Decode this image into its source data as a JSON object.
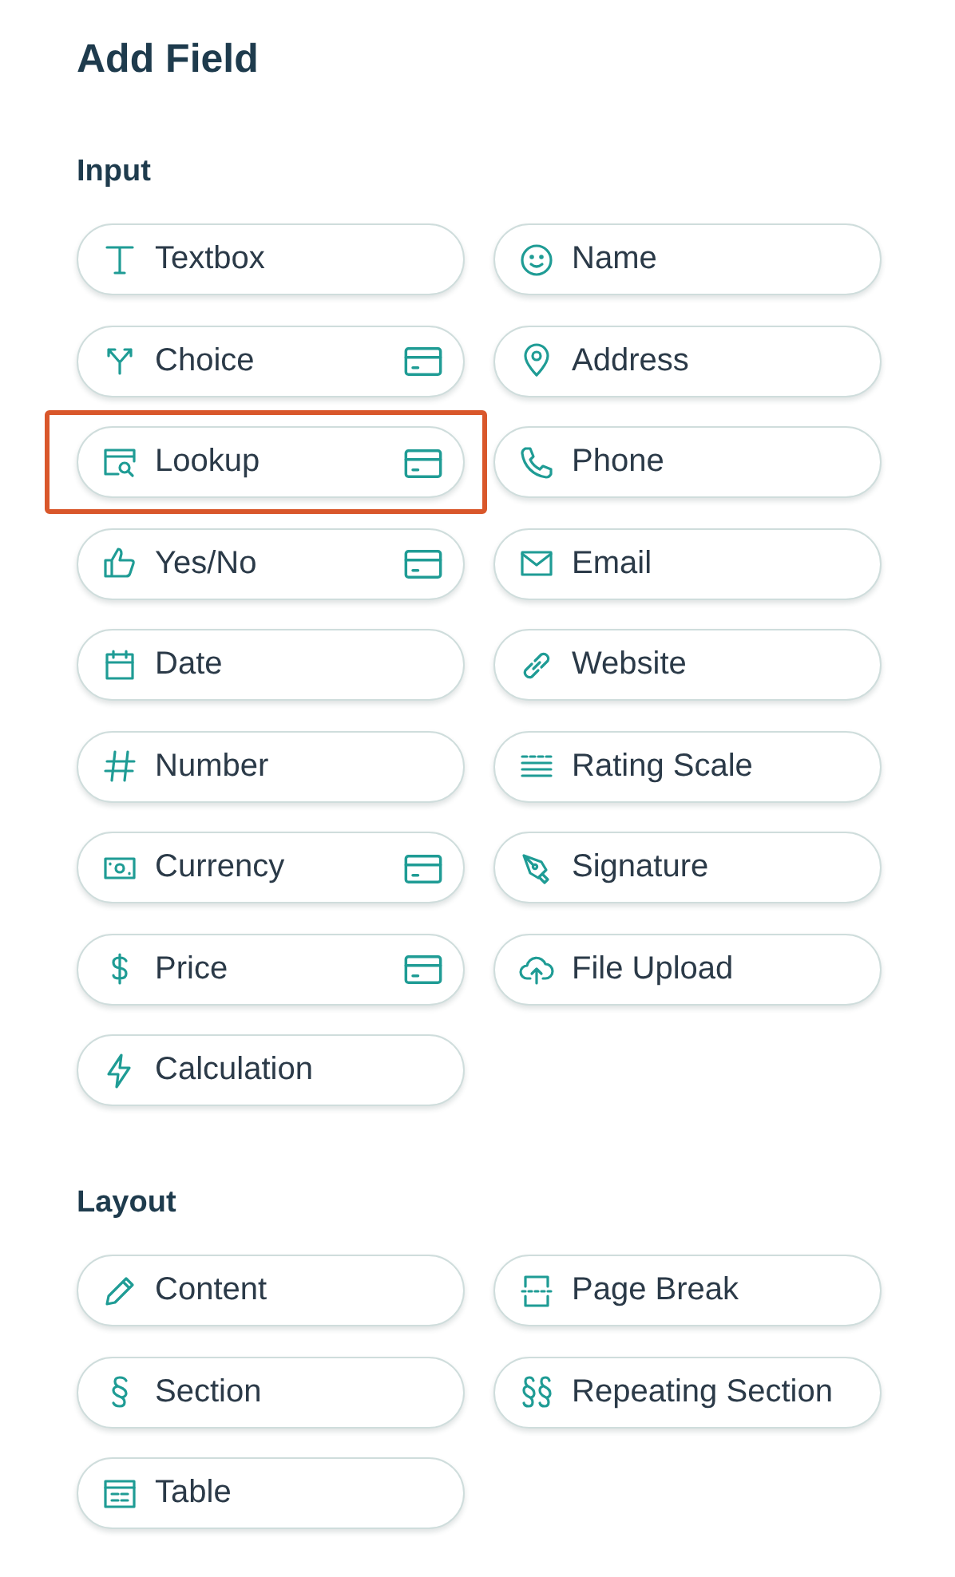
{
  "title": "Add Field",
  "sections": [
    {
      "heading": "Input",
      "items": [
        {
          "label": "Textbox",
          "premium": false,
          "highlighted": false
        },
        {
          "label": "Name",
          "premium": false,
          "highlighted": false
        },
        {
          "label": "Choice",
          "premium": true,
          "highlighted": false
        },
        {
          "label": "Address",
          "premium": false,
          "highlighted": false
        },
        {
          "label": "Lookup",
          "premium": true,
          "highlighted": true
        },
        {
          "label": "Phone",
          "premium": false,
          "highlighted": false
        },
        {
          "label": "Yes/No",
          "premium": true,
          "highlighted": false
        },
        {
          "label": "Email",
          "premium": false,
          "highlighted": false
        },
        {
          "label": "Date",
          "premium": false,
          "highlighted": false
        },
        {
          "label": "Website",
          "premium": false,
          "highlighted": false
        },
        {
          "label": "Number",
          "premium": false,
          "highlighted": false
        },
        {
          "label": "Rating Scale",
          "premium": false,
          "highlighted": false
        },
        {
          "label": "Currency",
          "premium": true,
          "highlighted": false
        },
        {
          "label": "Signature",
          "premium": false,
          "highlighted": false
        },
        {
          "label": "Price",
          "premium": true,
          "highlighted": false
        },
        {
          "label": "File Upload",
          "premium": false,
          "highlighted": false
        },
        {
          "label": "Calculation",
          "premium": false,
          "highlighted": false
        }
      ]
    },
    {
      "heading": "Layout",
      "items": [
        {
          "label": "Content",
          "premium": false,
          "highlighted": false
        },
        {
          "label": "Page Break",
          "premium": false,
          "highlighted": false
        },
        {
          "label": "Section",
          "premium": false,
          "highlighted": false
        },
        {
          "label": "Repeating Section",
          "premium": false,
          "highlighted": false
        },
        {
          "label": "Table",
          "premium": false,
          "highlighted": false
        }
      ]
    }
  ]
}
